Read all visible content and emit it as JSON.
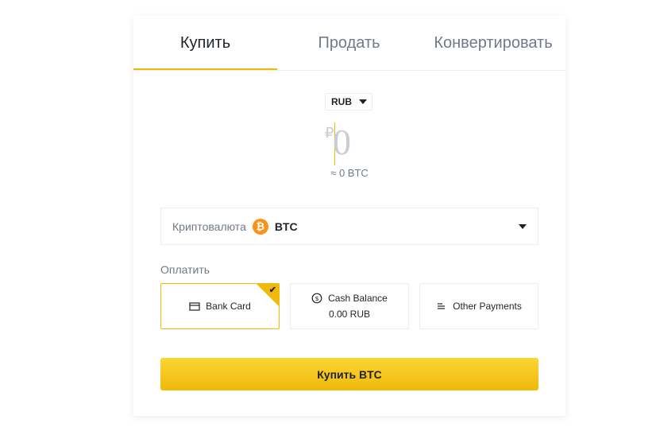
{
  "tabs": {
    "buy": "Купить",
    "sell": "Продать",
    "convert": "Конвертировать"
  },
  "fiat": {
    "currency": "RUB",
    "symbol": "₽",
    "amount": "0",
    "approx": "≈ 0 BTC"
  },
  "crypto": {
    "label": "Криптовалюта",
    "icon_glyph": "₿",
    "value": "BTC"
  },
  "payment": {
    "label": "Оплатить",
    "options": [
      {
        "label": "Bank Card",
        "selected": true
      },
      {
        "label": "Cash Balance",
        "sub": "0.00 RUB",
        "selected": false
      },
      {
        "label": "Other Payments",
        "selected": false
      }
    ]
  },
  "buy_button": "Купить BTC",
  "colors": {
    "accent": "#f0b90b",
    "button_top": "#fcd535",
    "text": "#1e2329",
    "muted": "#707a8a",
    "border": "#eaecef",
    "btc": "#f7931a"
  }
}
